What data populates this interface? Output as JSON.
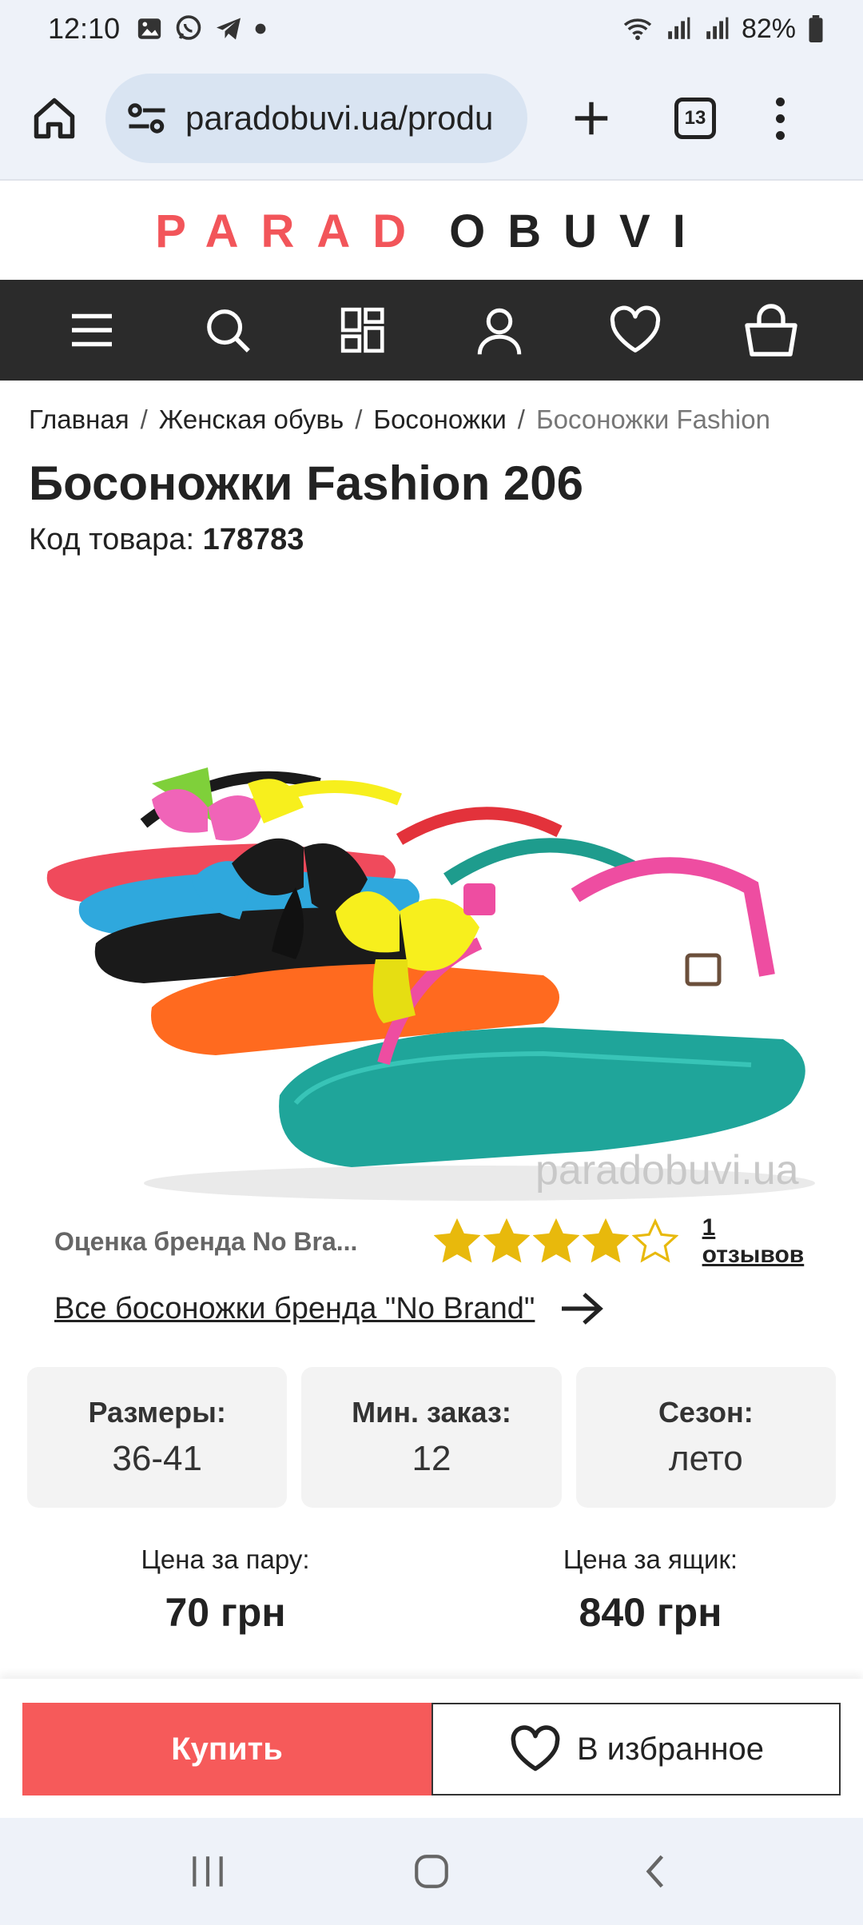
{
  "status_bar": {
    "time": "12:10",
    "battery": "82%",
    "notification_icons": [
      "gallery-icon",
      "viber-icon",
      "telegram-icon",
      "dot-icon"
    ],
    "system_icons": [
      "wifi-icon",
      "signal-icon",
      "signal-icon",
      "battery-icon"
    ]
  },
  "browser": {
    "url": "paradobuvi.ua/produ",
    "tab_count": "13"
  },
  "logo": {
    "part1": "PARAD",
    "part2": "OBUVI"
  },
  "nav": {
    "items": [
      "menu-icon",
      "search-icon",
      "catalog-icon",
      "user-icon",
      "heart-icon",
      "basket-icon"
    ]
  },
  "breadcrumb": {
    "items": [
      "Главная",
      "Женская обувь",
      "Босоножки",
      "Босоножки Fashion"
    ],
    "separator": "/"
  },
  "product": {
    "title": "Босоножки Fashion 206",
    "code_label": "Код товара:",
    "code_value": "178783",
    "watermark": "paradobuvi.ua",
    "brand_rating_label": "Оценка бренда No Bra...",
    "rating": 4,
    "rating_max": 5,
    "reviews_link": "1 отзывов",
    "brand_link": "Все босоножки бренда \"No Brand\""
  },
  "info_cards": [
    {
      "label": "Размеры:",
      "value": "36-41"
    },
    {
      "label": "Мин. заказ:",
      "value": "12"
    },
    {
      "label": "Сезон:",
      "value": "лето"
    }
  ],
  "prices": {
    "pair_label": "Цена за пару:",
    "pair_value": "70 грн",
    "box_label": "Цена за ящик:",
    "box_value": "840 грн"
  },
  "actions": {
    "buy_label": "Купить",
    "favorite_label": "В избранное"
  },
  "colors": {
    "accent_red": "#f65a5a",
    "logo_red": "#f2555a",
    "nav_bg": "#2b2b2b",
    "star_gold": "#e8b90c"
  }
}
